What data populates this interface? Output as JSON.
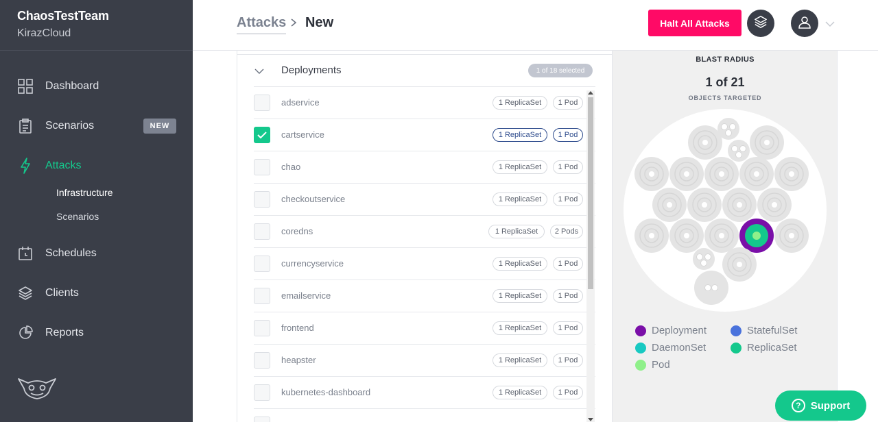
{
  "sidebar": {
    "team": "ChaosTestTeam",
    "org": "KirazCloud",
    "items": [
      {
        "label": "Dashboard",
        "icon": "grid-icon"
      },
      {
        "label": "Scenarios",
        "icon": "clipboard-icon",
        "badge": "NEW"
      },
      {
        "label": "Attacks",
        "icon": "bolt-icon",
        "active": true
      },
      {
        "label": "Schedules",
        "icon": "calendar-icon"
      },
      {
        "label": "Clients",
        "icon": "layers-icon"
      },
      {
        "label": "Reports",
        "icon": "pie-chart-icon"
      }
    ],
    "subitems": [
      {
        "label": "Infrastructure"
      },
      {
        "label": "Scenarios"
      }
    ]
  },
  "header": {
    "breadcrumb_parent": "Attacks",
    "breadcrumb_sep": ">",
    "breadcrumb_current": "New",
    "halt_label": "Halt All Attacks"
  },
  "deployments": {
    "title": "Deployments",
    "selected_text": "1 of 18 selected",
    "rows": [
      {
        "name": "adservice",
        "replicas": "1 ReplicaSet",
        "pods": "1 Pod",
        "checked": false
      },
      {
        "name": "cartservice",
        "replicas": "1 ReplicaSet",
        "pods": "1 Pod",
        "checked": true
      },
      {
        "name": "chao",
        "replicas": "1 ReplicaSet",
        "pods": "1 Pod",
        "checked": false
      },
      {
        "name": "checkoutservice",
        "replicas": "1 ReplicaSet",
        "pods": "1 Pod",
        "checked": false
      },
      {
        "name": "coredns",
        "replicas": "1 ReplicaSet",
        "pods": "2 Pods",
        "checked": false
      },
      {
        "name": "currencyservice",
        "replicas": "1 ReplicaSet",
        "pods": "1 Pod",
        "checked": false
      },
      {
        "name": "emailservice",
        "replicas": "1 ReplicaSet",
        "pods": "1 Pod",
        "checked": false
      },
      {
        "name": "frontend",
        "replicas": "1 ReplicaSet",
        "pods": "1 Pod",
        "checked": false
      },
      {
        "name": "heapster",
        "replicas": "1 ReplicaSet",
        "pods": "1 Pod",
        "checked": false
      },
      {
        "name": "kubernetes-dashboard",
        "replicas": "1 ReplicaSet",
        "pods": "1 Pod",
        "checked": false
      }
    ]
  },
  "blast": {
    "title": "BLAST RADIUS",
    "count": "1 of 21",
    "subtitle": "OBJECTS TARGETED",
    "legend": [
      {
        "label": "Deployment",
        "color": "#7a0fa8"
      },
      {
        "label": "StatefulSet",
        "color": "#4a72dc"
      },
      {
        "label": "DaemonSet",
        "color": "#18c9c2"
      },
      {
        "label": "ReplicaSet",
        "color": "#14c88c"
      },
      {
        "label": "Pod",
        "color": "#8ff08a"
      }
    ]
  },
  "support": {
    "label": "Support"
  },
  "colors": {
    "accent": "#14c88c",
    "halt": "#ff0a66",
    "sidebar": "#3a3e48"
  }
}
